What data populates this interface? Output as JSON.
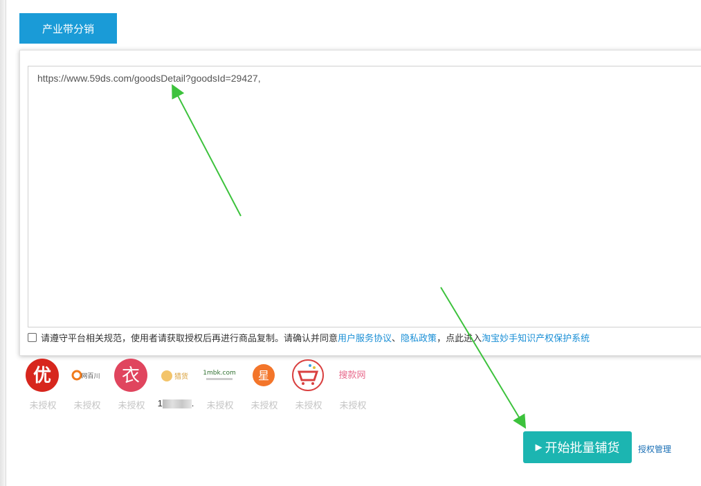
{
  "tab": {
    "label": "产业带分销"
  },
  "textarea": {
    "value": "https://www.59ds.com/goodsDetail?goodsId=29427,"
  },
  "consent": {
    "text": "请遵守平台相关规范，使用者请获取授权后再进行商品复制。请确认并同意",
    "link_terms": "用户服务协议",
    "sep": "、",
    "link_privacy": "隐私政策",
    "mid": "，点此进入",
    "link_ip": "淘宝妙手知识产权保护系统"
  },
  "platforms": [
    {
      "icon": "you-logo-icon",
      "glyph": "优",
      "label": "未授权"
    },
    {
      "icon": "wangbaichuan-logo-icon",
      "glyph": "网百川",
      "label": "未授权"
    },
    {
      "icon": "yi-logo-icon",
      "glyph": "衣",
      "label": "未授权"
    },
    {
      "icon": "zhaohuo-logo-icon",
      "glyph": "猎货",
      "label": "1"
    },
    {
      "icon": "1mbk-logo-icon",
      "glyph": "1mbk.com",
      "label": "未授权"
    },
    {
      "icon": "xing-logo-icon",
      "glyph": "星",
      "label": "未授权"
    },
    {
      "icon": "cart-logo-icon",
      "glyph": "",
      "label": "未授权"
    },
    {
      "icon": "soukuan-logo-icon",
      "glyph": "搜款网",
      "label": "未授权"
    }
  ],
  "actions": {
    "start_label": "开始批量铺货",
    "auth_label": "授权管理"
  },
  "colors": {
    "tab_bg": "#1a9bd7",
    "start_bg": "#1cb5b1",
    "link": "#1a8fd6",
    "annotation_arrow": "#3cc23c"
  }
}
